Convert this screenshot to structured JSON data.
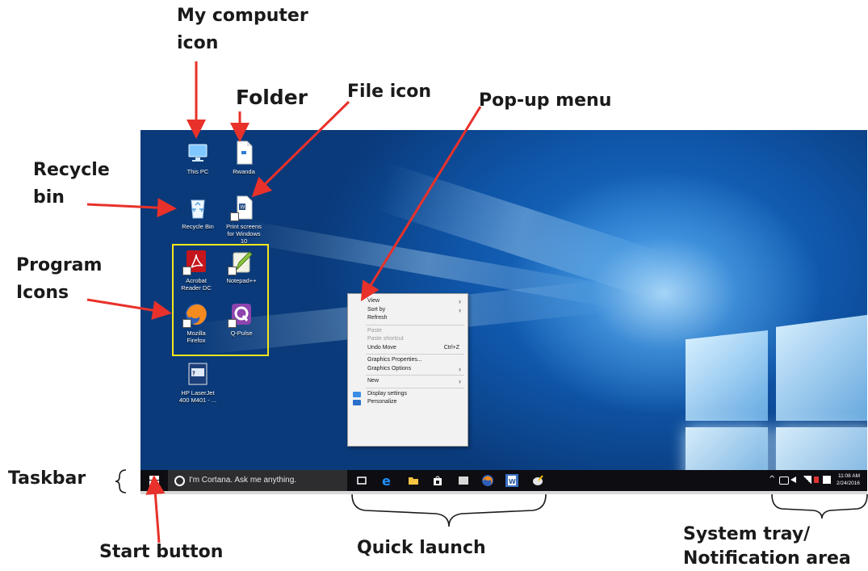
{
  "annotations": {
    "my_computer_line1": "My computer",
    "my_computer_line2": "icon",
    "folder": "Folder",
    "file_icon": "File icon",
    "popup_menu": "Pop-up menu",
    "recycle_line1": "Recycle",
    "recycle_line2": "bin",
    "program_line1": "Program",
    "program_line2": "Icons",
    "taskbar": "Taskbar",
    "start_button": "Start button",
    "quick_launch": "Quick launch",
    "system_tray_line1": "System tray/",
    "system_tray_line2": "Notification area"
  },
  "desktop_icons": {
    "this_pc": "This PC",
    "rwanda": "Rwanda",
    "recycle_bin": "Recycle Bin",
    "print_screens_1": "Print screens",
    "print_screens_2": "for Windows",
    "print_screens_3": "10",
    "acrobat_1": "Acrobat",
    "acrobat_2": "Reader DC",
    "notepad": "Notepad++",
    "firefox_1": "Mozilla",
    "firefox_2": "Firefox",
    "qpulse": "Q-Pulse",
    "hp_1": "HP LaserJet",
    "hp_2": "400 M401 - ..."
  },
  "context_menu": {
    "view": "View",
    "sort_by": "Sort by",
    "refresh": "Refresh",
    "paste": "Paste",
    "paste_shortcut": "Paste shortcut",
    "undo_move": "Undo Move",
    "undo_shortcut": "Ctrl+Z",
    "graphics_properties": "Graphics Properties...",
    "graphics_options": "Graphics Options",
    "new": "New",
    "display_settings": "Display settings",
    "personalize": "Personalize"
  },
  "taskbar": {
    "cortana_placeholder": "I'm Cortana. Ask me anything.",
    "time": "11:08 AM",
    "date": "2/24/2016"
  },
  "colors": {
    "arrow": "#e8312a",
    "highlight_box": "#f5e71d",
    "desktop_blue": "#0f55a8",
    "taskbar": "#0d0d12"
  }
}
